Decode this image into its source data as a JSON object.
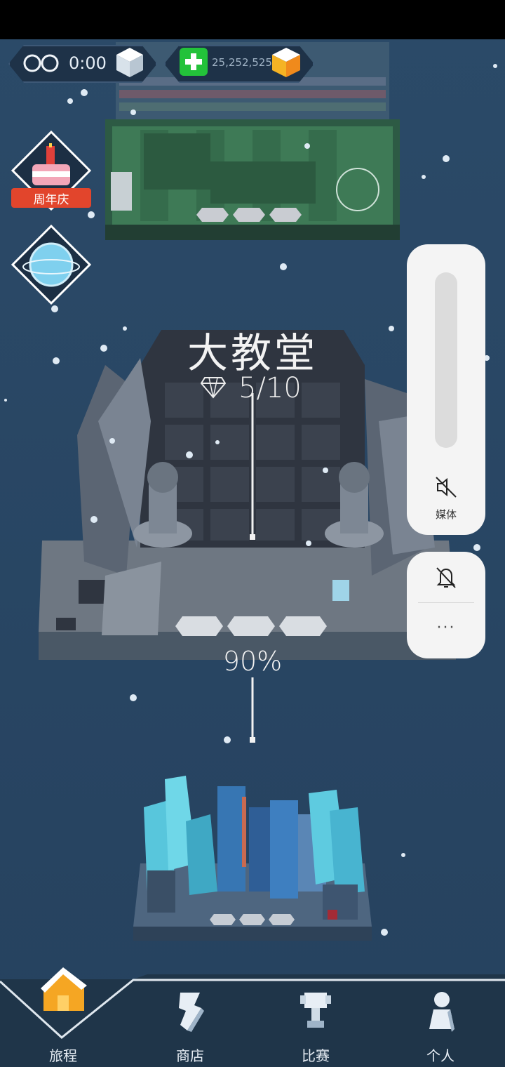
{
  "hud": {
    "timer_text": "0:00",
    "currency_text": "25,252,525"
  },
  "side": {
    "anniversary_label": "周年庆"
  },
  "level": {
    "title": "大教堂",
    "gems_text": "5/10",
    "progress_text": "90%"
  },
  "volume": {
    "media_label": "媒体",
    "more_label": "···"
  },
  "nav": {
    "items": [
      {
        "label": "旅程"
      },
      {
        "label": "商店"
      },
      {
        "label": "比赛"
      },
      {
        "label": "个人"
      }
    ]
  },
  "colors": {
    "background": "#2a4866",
    "hud_bg": "#1e3248",
    "accent_green": "#23c23a",
    "ribbon_red": "#e2452c"
  }
}
